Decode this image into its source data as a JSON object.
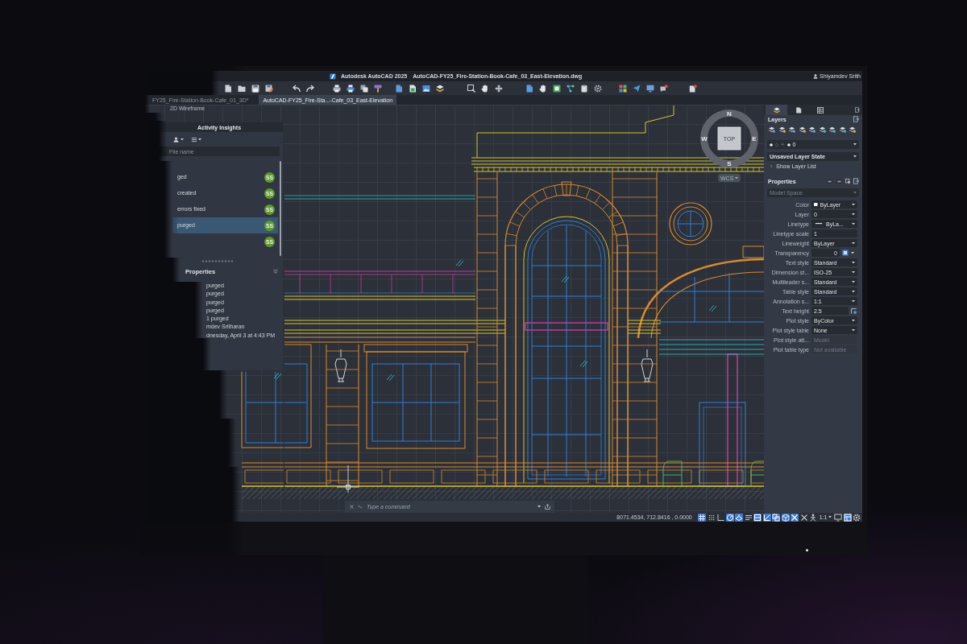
{
  "window": {
    "app_name": "Autodesk AutoCAD 2025",
    "document_title": "AutoCAD-FY25_Fire-Station-Book-Cafe_03_East-Elevation.dwg",
    "user_name": "Shiyamdev Srith"
  },
  "tabs": [
    {
      "label": "FY25_Fire-Station-Book-Cafe_01_3D*",
      "selected": false
    },
    {
      "label": "AutoCAD-FY25_Fire-Sta...-Cafe_03_East-Elevation",
      "selected": true
    }
  ],
  "viewport": {
    "visual_style": "2D Wireframe"
  },
  "viewcube": {
    "face": "TOP",
    "north": "N",
    "south": "S",
    "east": "E",
    "west": "W",
    "coordinate_system": "WCS"
  },
  "activity_insights": {
    "title": "Activity Insights",
    "search": {
      "placeholder": "File name"
    },
    "events": [
      {
        "title": "ged",
        "badge": "SS",
        "selected": false
      },
      {
        "title": "created",
        "badge": "SS",
        "selected": false
      },
      {
        "detail": "errors fixed",
        "badge": "SS",
        "selected": false
      },
      {
        "detail": "purged",
        "badge": "SS",
        "selected": true
      },
      {
        "badge": "SS",
        "selected": false
      }
    ],
    "details": {
      "title": "Properties",
      "lines": [
        "purged",
        "purged",
        "purged",
        "purged",
        "1 purged",
        "mdev Sritharan",
        "dnesday, April 3 at 4:43 PM"
      ]
    }
  },
  "command_line": {
    "placeholder": "Type a command"
  },
  "palette": {
    "tabs": [
      {
        "selected": true
      },
      {
        "selected": false
      },
      {
        "selected": false
      }
    ],
    "layers": {
      "title": "Layers",
      "current_layer": "0",
      "layer_state": "Unsaved Layer State",
      "show_list": "Show Layer List"
    },
    "properties": {
      "title": "Properties",
      "selection": "Model Space",
      "rows": [
        {
          "label": "Color",
          "value": "ByLayer",
          "kind": "color"
        },
        {
          "label": "Layer",
          "value": "0",
          "kind": "dropdown"
        },
        {
          "label": "Linetype",
          "value": "ByLa...",
          "kind": "linetype"
        },
        {
          "label": "Linetype scale",
          "value": "1",
          "kind": "input"
        },
        {
          "label": "Lineweight",
          "value": "ByLayer",
          "kind": "dropdown"
        },
        {
          "label": "Transparency",
          "value": "0",
          "kind": "transparency"
        },
        {
          "label": "Text style",
          "value": "Standard",
          "kind": "dropdown"
        },
        {
          "label": "Dimension st...",
          "value": "ISO-25",
          "kind": "dropdown"
        },
        {
          "label": "Multileader s...",
          "value": "Standard",
          "kind": "dropdown"
        },
        {
          "label": "Table style",
          "value": "Standard",
          "kind": "dropdown"
        },
        {
          "label": "Annotation s...",
          "value": "1:1",
          "kind": "dropdown"
        },
        {
          "label": "Text height",
          "value": "2.5",
          "kind": "height"
        },
        {
          "label": "Plot style",
          "value": "ByColor",
          "kind": "dropdown"
        },
        {
          "label": "Plot style table",
          "value": "None",
          "kind": "dropdown"
        },
        {
          "label": "Plot style att...",
          "value": "Model",
          "kind": "readonly"
        },
        {
          "label": "Plot table type",
          "value": "Not available",
          "kind": "readonly"
        }
      ]
    }
  },
  "status_bar": {
    "coordinates": "8071.4534, 712.8416 , 0.0000",
    "toggles": [
      {
        "on": true
      },
      {
        "on": false
      },
      {
        "on": false
      },
      {
        "on": true
      },
      {
        "on": true
      },
      {
        "on": false
      },
      {
        "on": true
      },
      {
        "on": true
      },
      {
        "on": true
      },
      {
        "on": true
      },
      {
        "on": true
      },
      {
        "on": false
      },
      {
        "on": false
      }
    ],
    "annotation_scale": "1:1",
    "tools": [
      {
        "on": false
      },
      {
        "on": true
      },
      {
        "on": false
      }
    ]
  }
}
